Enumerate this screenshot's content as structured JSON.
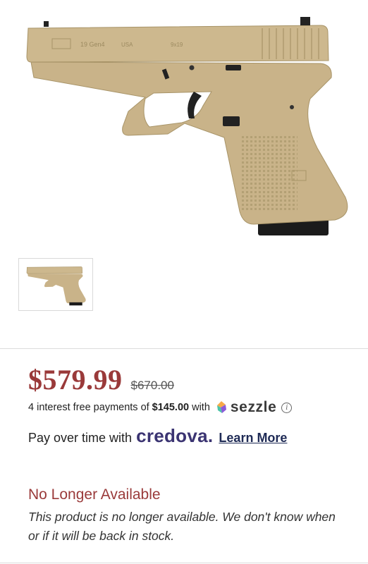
{
  "product": {
    "price": "$579.99",
    "old_price": "$670.00",
    "slide_text": {
      "model": "19 Gen4",
      "origin": "USA",
      "caliber": "9x19"
    }
  },
  "payments": {
    "sezzle_prefix": "4 interest free payments of",
    "sezzle_amount": "$145.00",
    "sezzle_suffix": "with",
    "sezzle_brand": "sezzle",
    "credova_prefix": "Pay over time with",
    "credova_brand": "credova.",
    "learn_more": "Learn More"
  },
  "availability": {
    "title": "No Longer Available",
    "message": "This product is no longer available. We don't know when or if it will be back in stock."
  },
  "colors": {
    "price": "#9a3a3a",
    "credova": "#3b3472",
    "tan": "#cdb88e"
  },
  "icons": [
    "sezzle-logo-icon",
    "info-icon"
  ]
}
